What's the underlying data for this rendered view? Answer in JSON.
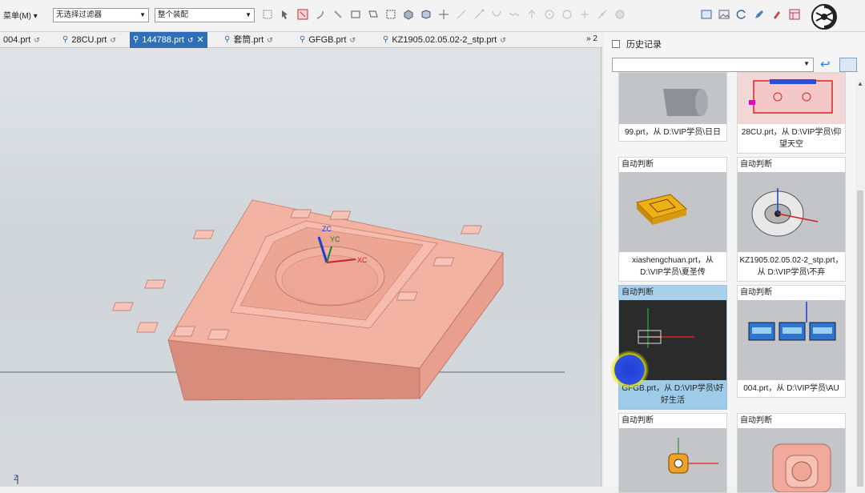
{
  "toolbar": {
    "menu_label": "菜单(M)",
    "filter_select": "无选择过滤器",
    "assembly_select": "整个装配"
  },
  "tabs": [
    {
      "label": "004.prt",
      "active": false
    },
    {
      "label": "28CU.prt",
      "active": false
    },
    {
      "label": "144788.prt",
      "active": true
    },
    {
      "label": "套筒.prt",
      "active": false
    },
    {
      "label": "GFGB.prt",
      "active": false
    },
    {
      "label": "KZ1905.02.05.02-2_stp.prt",
      "active": false
    }
  ],
  "tabs_more": "» 2",
  "viewport": {
    "axis_labels": {
      "zc": "ZC",
      "yc": "YC",
      "xc": "XC"
    },
    "triad_z": "Z",
    "model_color": "#f1a999"
  },
  "panel": {
    "title": "历史记录",
    "cards": [
      {
        "header": "",
        "caption": "99.prt，从 D:\\VIP学员\\日日",
        "thumb": "part-99"
      },
      {
        "header": "",
        "caption": "28CU.prt，从 D:\\VIP学员\\仰望天空",
        "thumb": "part-28cu"
      },
      {
        "header": "自动判断",
        "caption": "xiashengchuan.prt，从 D:\\VIP学员\\夏圣传",
        "thumb": "part-xsc"
      },
      {
        "header": "自动判断",
        "caption": "KZ1905.02.05.02-2_stp.prt，从 D:\\VIP学员\\不弃",
        "thumb": "part-kz"
      },
      {
        "header": "自动判断",
        "caption": "GFGB.prt，从 D:\\VIP学员\\好好生活",
        "thumb": "part-gfgb",
        "selected": true
      },
      {
        "header": "自动判断",
        "caption": "004.prt，从 D:\\VIP学员\\AU",
        "thumb": "part-004"
      },
      {
        "header": "自动判断",
        "caption": "",
        "thumb": "part-a"
      },
      {
        "header": "自动判断",
        "caption": "",
        "thumb": "part-b"
      }
    ]
  }
}
